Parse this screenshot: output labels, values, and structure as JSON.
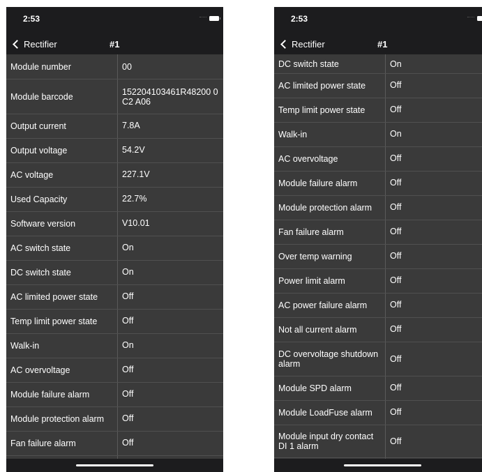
{
  "left": {
    "status": {
      "time": "2:53"
    },
    "nav": {
      "back_label": "Rectifier",
      "title": "#1"
    },
    "rows": [
      {
        "label": "Module number",
        "value": "00"
      },
      {
        "label": "Module barcode",
        "value": "152204103461R48200 0C2 A06"
      },
      {
        "label": "Output current",
        "value": "7.8A"
      },
      {
        "label": "Output voltage",
        "value": "54.2V"
      },
      {
        "label": "AC voltage",
        "value": "227.1V"
      },
      {
        "label": "Used Capacity",
        "value": "22.7%"
      },
      {
        "label": "Software version",
        "value": "V10.01"
      },
      {
        "label": "AC switch state",
        "value": "On"
      },
      {
        "label": "DC switch state",
        "value": "On"
      },
      {
        "label": "AC limited power state",
        "value": "Off"
      },
      {
        "label": "Temp limit power state",
        "value": "Off"
      },
      {
        "label": "Walk-in",
        "value": "On"
      },
      {
        "label": "AC overvoltage",
        "value": "Off"
      },
      {
        "label": "Module failure alarm",
        "value": "Off"
      },
      {
        "label": "Module protection alarm",
        "value": "Off"
      },
      {
        "label": "Fan failure alarm",
        "value": "Off"
      }
    ]
  },
  "right": {
    "status": {
      "time": "2:53"
    },
    "nav": {
      "back_label": "Rectifier",
      "title": "#1"
    },
    "rows": [
      {
        "label": "DC switch state",
        "value": "On"
      },
      {
        "label": "AC limited power state",
        "value": "Off"
      },
      {
        "label": "Temp limit power state",
        "value": "Off"
      },
      {
        "label": "Walk-in",
        "value": "On"
      },
      {
        "label": "AC overvoltage",
        "value": "Off"
      },
      {
        "label": "Module failure alarm",
        "value": "Off"
      },
      {
        "label": "Module protection alarm",
        "value": "Off"
      },
      {
        "label": "Fan failure alarm",
        "value": "Off"
      },
      {
        "label": "Over temp warning",
        "value": "Off"
      },
      {
        "label": "Power limit alarm",
        "value": "Off"
      },
      {
        "label": "AC power failure alarm",
        "value": "Off"
      },
      {
        "label": "Not all current alarm",
        "value": "Off"
      },
      {
        "label": "DC overvoltage shutdown alarm",
        "value": "Off"
      },
      {
        "label": "Module SPD alarm",
        "value": "Off"
      },
      {
        "label": "Module LoadFuse alarm",
        "value": "Off"
      },
      {
        "label": "Module input dry contact DI 1 alarm",
        "value": "Off"
      }
    ]
  }
}
